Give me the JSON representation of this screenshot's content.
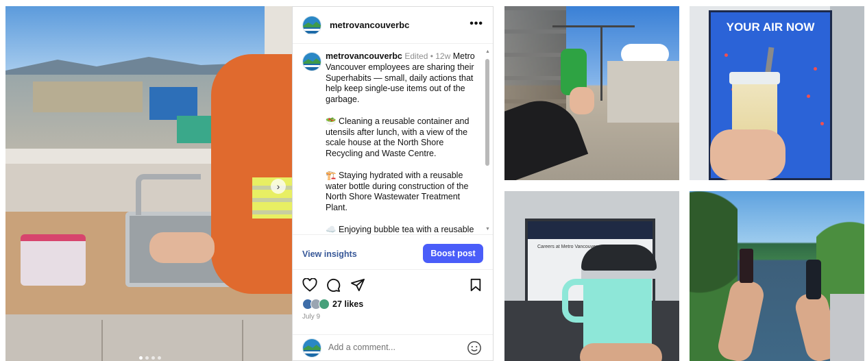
{
  "post": {
    "username": "metrovancouverbc",
    "more_icon": "more-horizontal-icon",
    "caption": {
      "username": "metrovancouverbc",
      "meta": "Edited • 12w",
      "intro": "Metro Vancouver employees are sharing their Superhabits — small, daily actions that help keep single-use items out of the garbage.",
      "item1": "🥗 Cleaning a reusable container and utensils after lunch, with a view of the scale house at the North Shore Recycling and Waste Centre.",
      "item2": "🏗️ Staying hydrated with a reusable water bottle during construction of the North Shore Wastewater Treatment Plant.",
      "item3": "☁️ Enjoying bubble tea with a reusable"
    },
    "view_insights": "View insights",
    "boost_post": "Boost post",
    "likes": "27 likes",
    "date": "July 9",
    "comment_placeholder": "Add a comment...",
    "carousel": {
      "count": 4,
      "active_index": 0
    }
  },
  "thumbnails": {
    "t2_sign_text": "YOUR AIR NOW",
    "t3_screen_text": "Careers at Metro Vancouver"
  },
  "colors": {
    "boost_button": "#4a5df9",
    "insights_link": "#385898",
    "muted_text": "#8e8e8e"
  }
}
